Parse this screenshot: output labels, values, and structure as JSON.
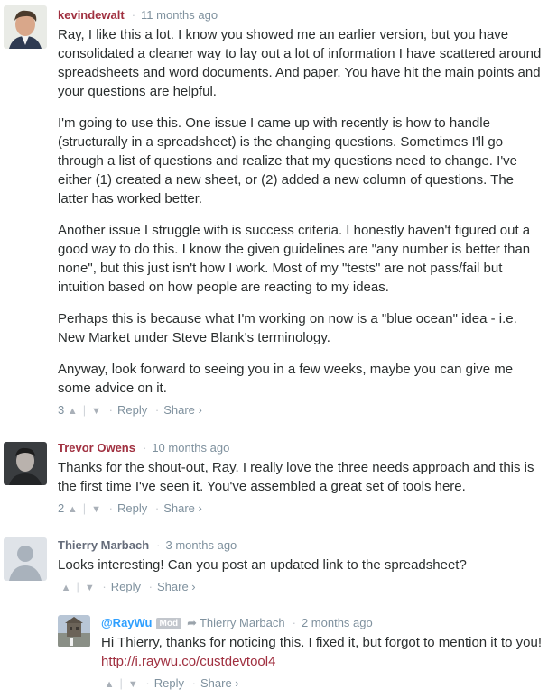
{
  "comments": [
    {
      "author": "kevindewalt",
      "time": "11 months ago",
      "avatar": "user-portrait-icon",
      "paragraphs": [
        "Ray, I like this a lot.  I know you showed me an earlier version, but you have consolidated a cleaner way to lay out a lot of information I have scattered around spreadsheets and word documents.  And paper.  You have hit the main points and your questions are helpful.",
        "I'm going to use this.  One issue I came up with recently is how to handle (structurally in a spreadsheet) is the changing questions.  Sometimes I'll go through a list of questions and realize that my questions need to change.  I've either (1) created a new sheet, or (2) added a new column of questions.  The latter has worked better.",
        "Another issue I struggle with is success criteria.  I honestly haven't figured out a good way to do this. I know the given guidelines are \"any number is better than none\", but this just isn't how I work. Most of my \"tests\" are not pass/fail but intuition based on how people are reacting to my ideas.",
        "Perhaps this is because what I'm working on now is a \"blue ocean\" idea - i.e. New Market under Steve Blank's terminology.",
        "Anyway, look forward to seeing you in a few weeks, maybe you can give me some advice on it."
      ],
      "votes": "3",
      "reply": "Reply",
      "share": "Share ›"
    },
    {
      "author": "Trevor Owens",
      "time": "10 months ago",
      "avatar": "user-portrait-icon",
      "text": "Thanks for the shout-out, Ray. I really love the three needs approach and this is the first time I've seen it. You've assembled a great set of tools here.",
      "votes": "2",
      "reply": "Reply",
      "share": "Share ›"
    },
    {
      "author": "Thierry Marbach",
      "time": "3 months ago",
      "avatar": "default-avatar-icon",
      "text": "Looks interesting! Can you post an updated link to the spreadsheet?",
      "votes": "",
      "reply": "Reply",
      "share": "Share ›"
    },
    {
      "author": "@RayWu",
      "badge": "Mod",
      "reply_to": "Thierry Marbach",
      "time": "2 months ago",
      "avatar": "building-photo-icon",
      "text_before": "Hi Thierry, thanks for noticing this. I fixed it, but forgot to mention it to you! ",
      "link": "http://i.raywu.co/custdevtool4",
      "votes": "",
      "reply": "Reply",
      "share": "Share ›"
    }
  ],
  "colors": {
    "author": "#a03040",
    "meta": "#7f919e",
    "text": "#2a2e2e",
    "link": "#a03040"
  }
}
